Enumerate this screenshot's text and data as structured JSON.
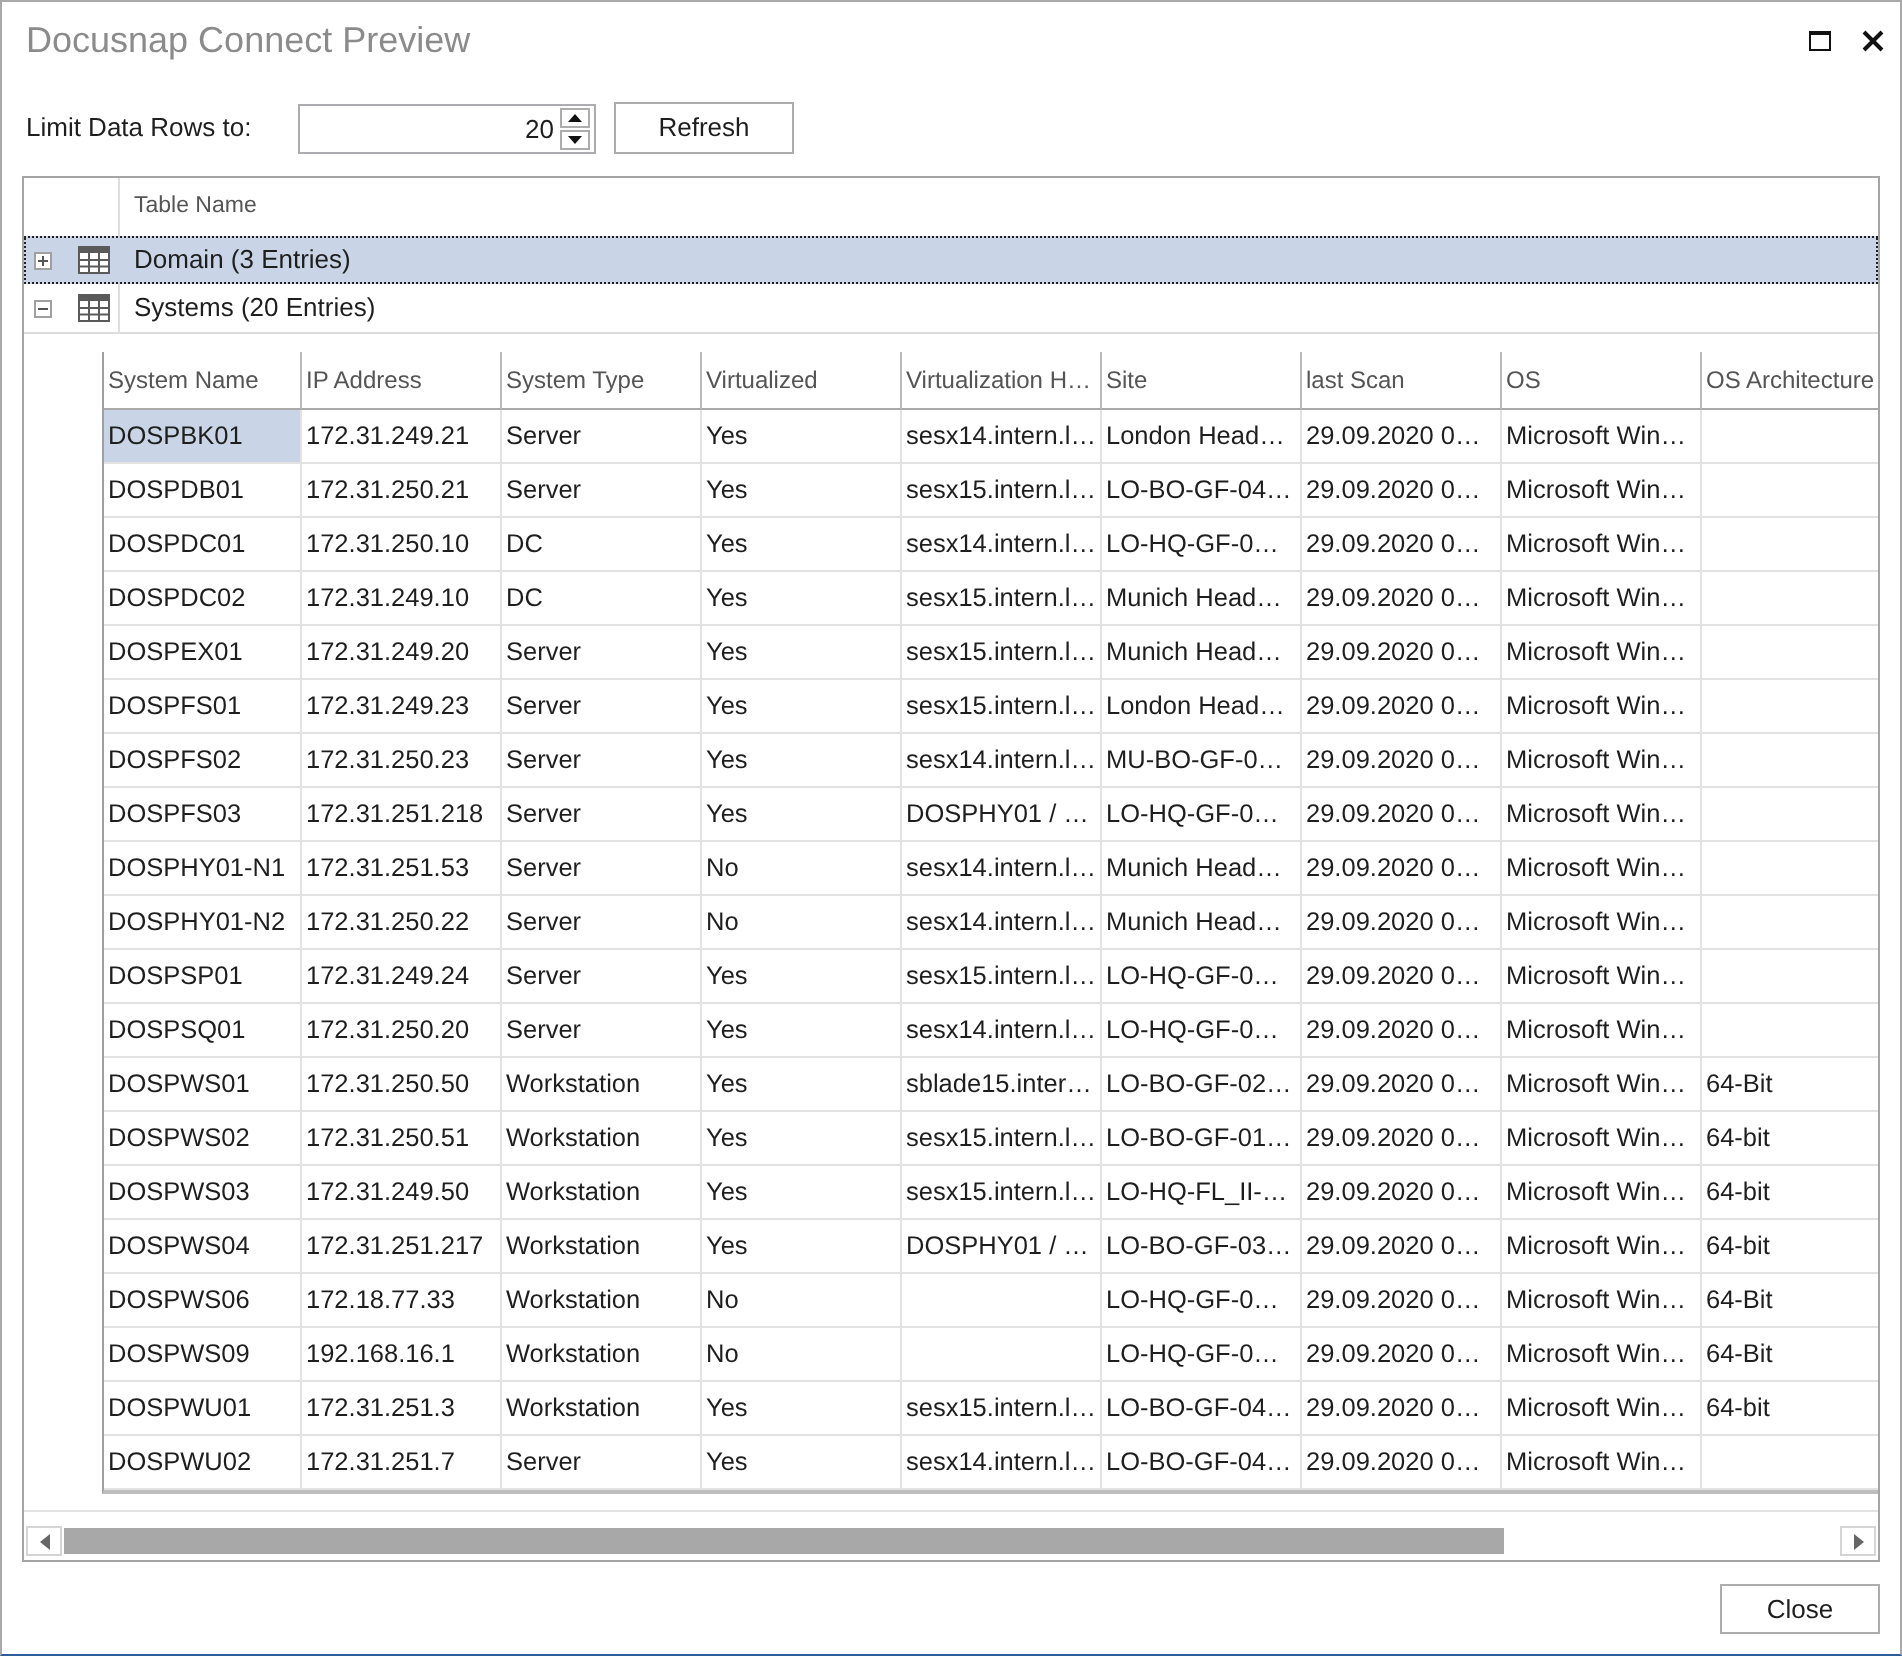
{
  "window": {
    "title": "Docusnap Connect Preview"
  },
  "limit": {
    "label": "Limit Data Rows to:",
    "value": "20"
  },
  "refresh_button": "Refresh",
  "tree_grid": {
    "column": "Table Name",
    "items": [
      {
        "label": "Domain (3 Entries)",
        "expanded": false,
        "selected": true
      },
      {
        "label": "Systems (20 Entries)",
        "expanded": true,
        "selected": false,
        "table": {
          "columns": [
            {
              "label": "System Name",
              "selected": true
            },
            {
              "label": "IP Address",
              "selected": false
            },
            {
              "label": "System Type",
              "selected": false
            },
            {
              "label": "Virtualized",
              "selected": false
            },
            {
              "label": "Virtualization H…",
              "selected": false
            },
            {
              "label": "Site",
              "selected": false
            },
            {
              "label": "last Scan",
              "selected": false
            },
            {
              "label": "OS",
              "selected": false
            },
            {
              "label": "OS Architecture",
              "selected": false
            }
          ],
          "rows": [
            {
              "selected": true,
              "cells": [
                "DOSPBK01",
                "172.31.249.21",
                "Server",
                "Yes",
                "sesx14.intern.l…",
                "London Head…",
                "29.09.2020 0…",
                "Microsoft Win…",
                null
              ]
            },
            {
              "selected": false,
              "cells": [
                "DOSPDB01",
                "172.31.250.21",
                "Server",
                "Yes",
                "sesx15.intern.l…",
                "LO-BO-GF-04…",
                "29.09.2020 0…",
                "Microsoft Win…",
                null
              ]
            },
            {
              "selected": false,
              "cells": [
                "DOSPDC01",
                "172.31.250.10",
                "DC",
                "Yes",
                "sesx14.intern.l…",
                "LO-HQ-GF-0…",
                "29.09.2020 0…",
                "Microsoft Win…",
                null
              ]
            },
            {
              "selected": false,
              "cells": [
                "DOSPDC02",
                "172.31.249.10",
                "DC",
                "Yes",
                "sesx15.intern.l…",
                "Munich Head…",
                "29.09.2020 0…",
                "Microsoft Win…",
                null
              ]
            },
            {
              "selected": false,
              "cells": [
                "DOSPEX01",
                "172.31.249.20",
                "Server",
                "Yes",
                "sesx15.intern.l…",
                "Munich Head…",
                "29.09.2020 0…",
                "Microsoft Win…",
                null
              ]
            },
            {
              "selected": false,
              "cells": [
                "DOSPFS01",
                "172.31.249.23",
                "Server",
                "Yes",
                "sesx15.intern.l…",
                "London Head…",
                "29.09.2020 0…",
                "Microsoft Win…",
                null
              ]
            },
            {
              "selected": false,
              "cells": [
                "DOSPFS02",
                "172.31.250.23",
                "Server",
                "Yes",
                "sesx14.intern.l…",
                "MU-BO-GF-0…",
                "29.09.2020 0…",
                "Microsoft Win…",
                null
              ]
            },
            {
              "selected": false,
              "cells": [
                "DOSPFS03",
                "172.31.251.218",
                "Server",
                "Yes",
                "DOSPHY01 / …",
                "LO-HQ-GF-0…",
                "29.09.2020 0…",
                "Microsoft Win…",
                null
              ]
            },
            {
              "selected": false,
              "cells": [
                "DOSPHY01-N1",
                "172.31.251.53",
                "Server",
                "No",
                "sesx14.intern.l…",
                "Munich Head…",
                "29.09.2020 0…",
                "Microsoft Win…",
                null
              ]
            },
            {
              "selected": false,
              "cells": [
                "DOSPHY01-N2",
                "172.31.250.22",
                "Server",
                "No",
                "sesx14.intern.l…",
                "Munich Head…",
                "29.09.2020 0…",
                "Microsoft Win…",
                null
              ]
            },
            {
              "selected": false,
              "cells": [
                "DOSPSP01",
                "172.31.249.24",
                "Server",
                "Yes",
                "sesx15.intern.l…",
                "LO-HQ-GF-0…",
                "29.09.2020 0…",
                "Microsoft Win…",
                null
              ]
            },
            {
              "selected": false,
              "cells": [
                "DOSPSQ01",
                "172.31.250.20",
                "Server",
                "Yes",
                "sesx14.intern.l…",
                "LO-HQ-GF-0…",
                "29.09.2020 0…",
                "Microsoft Win…",
                null
              ]
            },
            {
              "selected": false,
              "cells": [
                "DOSPWS01",
                "172.31.250.50",
                "Workstation",
                "Yes",
                "sblade15.inter…",
                "LO-BO-GF-02…",
                "29.09.2020 0…",
                "Microsoft Win…",
                "64-Bit"
              ]
            },
            {
              "selected": false,
              "cells": [
                "DOSPWS02",
                "172.31.250.51",
                "Workstation",
                "Yes",
                "sesx15.intern.l…",
                "LO-BO-GF-01…",
                "29.09.2020 0…",
                "Microsoft Win…",
                "64-bit"
              ]
            },
            {
              "selected": false,
              "cells": [
                "DOSPWS03",
                "172.31.249.50",
                "Workstation",
                "Yes",
                "sesx15.intern.l…",
                "LO-HQ-FL_II-…",
                "29.09.2020 0…",
                "Microsoft Win…",
                "64-bit"
              ]
            },
            {
              "selected": false,
              "cells": [
                "DOSPWS04",
                "172.31.251.217",
                "Workstation",
                "Yes",
                "DOSPHY01 / …",
                "LO-BO-GF-03…",
                "29.09.2020 0…",
                "Microsoft Win…",
                "64-bit"
              ]
            },
            {
              "selected": false,
              "cells": [
                "DOSPWS06",
                "172.18.77.33",
                "Workstation",
                "No",
                null,
                "LO-HQ-GF-0…",
                "29.09.2020 0…",
                "Microsoft Win…",
                "64-Bit"
              ]
            },
            {
              "selected": false,
              "cells": [
                "DOSPWS09",
                "192.168.16.1",
                "Workstation",
                "No",
                null,
                "LO-HQ-GF-0…",
                "29.09.2020 0…",
                "Microsoft Win…",
                "64-Bit"
              ]
            },
            {
              "selected": false,
              "cells": [
                "DOSPWU01",
                "172.31.251.3",
                "Workstation",
                "Yes",
                "sesx15.intern.l…",
                "LO-BO-GF-04…",
                "29.09.2020 0…",
                "Microsoft Win…",
                "64-bit"
              ]
            },
            {
              "selected": false,
              "cells": [
                "DOSPWU02",
                "172.31.251.7",
                "Server",
                "Yes",
                "sesx14.intern.l…",
                "LO-BO-GF-04…",
                "29.09.2020 0…",
                "Microsoft Win…",
                null
              ]
            }
          ]
        }
      }
    ]
  },
  "close_button": "Close"
}
